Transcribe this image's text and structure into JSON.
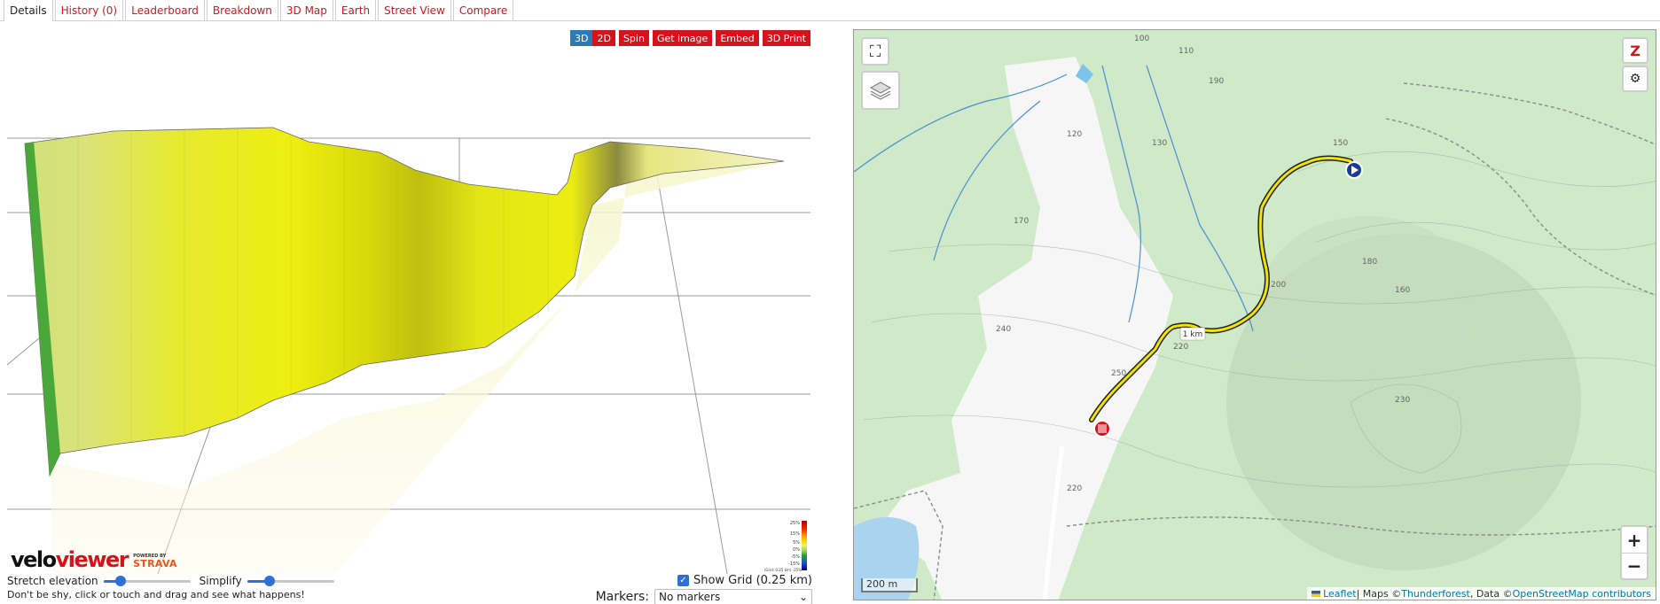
{
  "tabs": [
    {
      "label": "Details",
      "active": true
    },
    {
      "label": "History (0)"
    },
    {
      "label": "Leaderboard"
    },
    {
      "label": "Breakdown"
    },
    {
      "label": "3D Map"
    },
    {
      "label": "Earth"
    },
    {
      "label": "Street View"
    },
    {
      "label": "Compare"
    }
  ],
  "viewer": {
    "view_3d": "3D",
    "view_2d": "2D",
    "spin": "Spin",
    "get_image": "Get image",
    "embed": "Embed",
    "print3d": "3D Print",
    "legend": [
      "25%",
      "15%",
      "5%",
      "0%",
      "-5%",
      "-15%",
      "-25%"
    ],
    "legend_note": "(Grid: 0.25 km) -25%",
    "logo_velo": "velo",
    "logo_viewer": "viewer",
    "powered_by": "POWERED BY",
    "strava": "STRAVA"
  },
  "controls": {
    "stretch_label": "Stretch elevation",
    "stretch_value": 0.15,
    "simplify_label": "Simplify",
    "simplify_value": 0.22,
    "hint": "Don't be shy, click or touch and drag and see what happens!",
    "show_grid_label": "Show Grid (0.25 km)",
    "show_grid_checked": true,
    "markers_label": "Markers:",
    "markers_value": "No markers"
  },
  "map": {
    "scale": "200 m",
    "km_marker": "1 km",
    "contours": [
      "100",
      "110",
      "120",
      "130",
      "150",
      "160",
      "170",
      "180",
      "190",
      "200",
      "220",
      "230",
      "240",
      "250",
      "220"
    ],
    "attribution": {
      "leaflet": "Leaflet",
      "sep1": " | Maps © ",
      "thunderforest": "Thunderforest",
      "sep2": ", Data © ",
      "osm": "OpenStreetMap contributors"
    },
    "zoom_in": "+",
    "zoom_out": "−"
  },
  "colors": {
    "tab_red": "#d4141c",
    "toggle_blue": "#2a7ab8",
    "route_yellow": "#f2e600",
    "forest_green": "#cfe9c9"
  }
}
